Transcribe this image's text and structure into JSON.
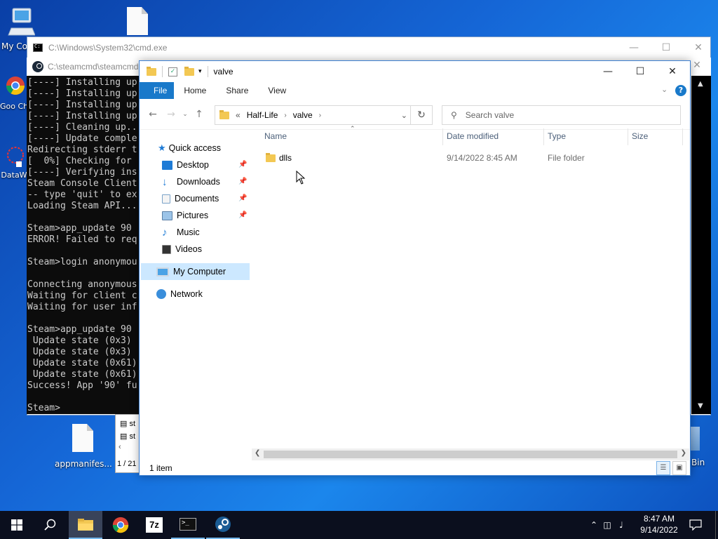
{
  "desktop": {
    "icons": [
      {
        "label": "My Co"
      },
      {
        "label": "Goo Chro"
      },
      {
        "label": "DataW"
      },
      {
        "label": "appmanifes..."
      },
      {
        "label": "Bin"
      }
    ]
  },
  "cmd_window": {
    "title": "C:\\Windows\\System32\\cmd.exe"
  },
  "steamcmd_window": {
    "title": "C:\\steamcmd\\steamcmd",
    "console_lines": [
      "[----] Installing up",
      "[----] Installing up",
      "[----] Installing up",
      "[----] Installing up",
      "[----] Cleaning up..",
      "[----] Update comple",
      "Redirecting stderr t",
      "[  0%] Checking for",
      "[----] Verifying ins",
      "Steam Console Client",
      "-- type 'quit' to ex",
      "Loading Steam API...",
      "",
      "Steam>app_update 90",
      "ERROR! Failed to req",
      "",
      "Steam>login anonymou",
      "",
      "Connecting anonymous",
      "Waiting for client c",
      "Waiting for user inf",
      "",
      "Steam>app_update 90",
      " Update state (0x3)",
      " Update state (0x3)",
      " Update state (0x61)",
      " Update state (0x61)",
      "Success! App '90' fu",
      "",
      "Steam>"
    ]
  },
  "small_window": {
    "rows": [
      "st",
      "st"
    ],
    "page": "1 / 21"
  },
  "explorer": {
    "title": "valve",
    "ribbon_tabs": [
      "File",
      "Home",
      "Share",
      "View"
    ],
    "address": {
      "root": "«",
      "crumbs": [
        "Half-Life",
        "valve"
      ]
    },
    "search_placeholder": "Search valve",
    "nav_items": [
      {
        "label": "Quick access",
        "icon": "star-icon",
        "pinned": false
      },
      {
        "label": "Desktop",
        "icon": "desktop-folder-icon",
        "pinned": true
      },
      {
        "label": "Downloads",
        "icon": "downloads-icon",
        "pinned": true
      },
      {
        "label": "Documents",
        "icon": "documents-icon",
        "pinned": true
      },
      {
        "label": "Pictures",
        "icon": "pictures-icon",
        "pinned": true
      },
      {
        "label": "Music",
        "icon": "music-icon",
        "pinned": false
      },
      {
        "label": "Videos",
        "icon": "videos-icon",
        "pinned": false
      },
      {
        "label": "My Computer",
        "icon": "computer-icon",
        "pinned": false,
        "selected": true
      },
      {
        "label": "Network",
        "icon": "network-icon",
        "pinned": false
      }
    ],
    "columns": [
      "Name",
      "Date modified",
      "Type",
      "Size"
    ],
    "files": [
      {
        "name": "dlls",
        "date_modified": "9/14/2022 8:45 AM",
        "type": "File folder",
        "size": ""
      }
    ],
    "status": "1 item"
  },
  "taskbar": {
    "clock_time": "8:47 AM",
    "clock_date": "9/14/2022",
    "apps": [
      "Windows Explorer",
      "Google Chrome",
      "7-Zip",
      "Command Prompt",
      "Steam"
    ]
  },
  "colors": {
    "accent": "#1979ca",
    "selection": "#cce8ff",
    "console_bg": "#0c0c0c",
    "taskbar_bg": "#0b0f1e"
  }
}
